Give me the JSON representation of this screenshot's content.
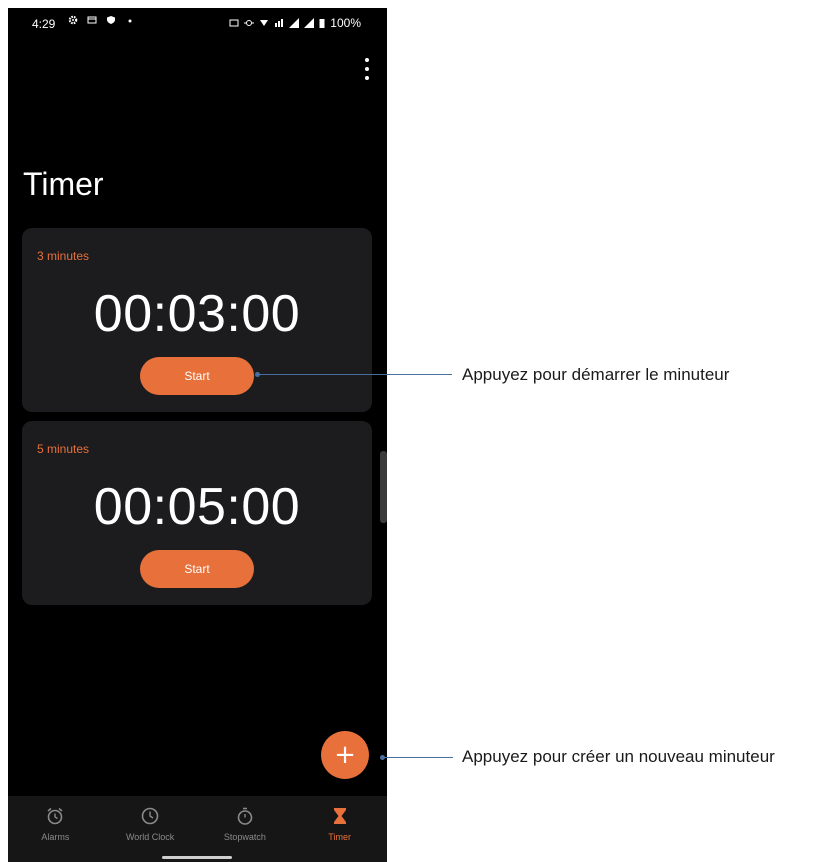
{
  "status_bar": {
    "time": "4:29",
    "battery": "100%",
    "left_icons": [
      "gear-icon",
      "notification-icon",
      "shield-icon",
      "dot-icon"
    ],
    "right_icons": [
      "nfc-icon",
      "vibrate-icon",
      "wifi-icon",
      "data-icon",
      "signal-icon",
      "signal-icon-2",
      "battery-icon"
    ]
  },
  "page": {
    "title": "Timer"
  },
  "timers": [
    {
      "label": "3 minutes",
      "value": "00:03:00",
      "start_label": "Start"
    },
    {
      "label": "5 minutes",
      "value": "00:05:00",
      "start_label": "Start"
    }
  ],
  "fab": {
    "label": "+"
  },
  "nav": {
    "items": [
      {
        "label": "Alarms",
        "icon": "alarm-icon"
      },
      {
        "label": "World Clock",
        "icon": "clock-icon"
      },
      {
        "label": "Stopwatch",
        "icon": "stopwatch-icon"
      },
      {
        "label": "Timer",
        "icon": "hourglass-icon"
      }
    ],
    "active": "Timer"
  },
  "annotations": {
    "start": "Appuyez pour démarrer le minuteur",
    "add": "Appuyez pour créer un nouveau minuteur"
  },
  "colors": {
    "accent": "#e8703a",
    "background": "#000000",
    "card": "#1c1c1e",
    "callout": "#4a6ea0"
  }
}
